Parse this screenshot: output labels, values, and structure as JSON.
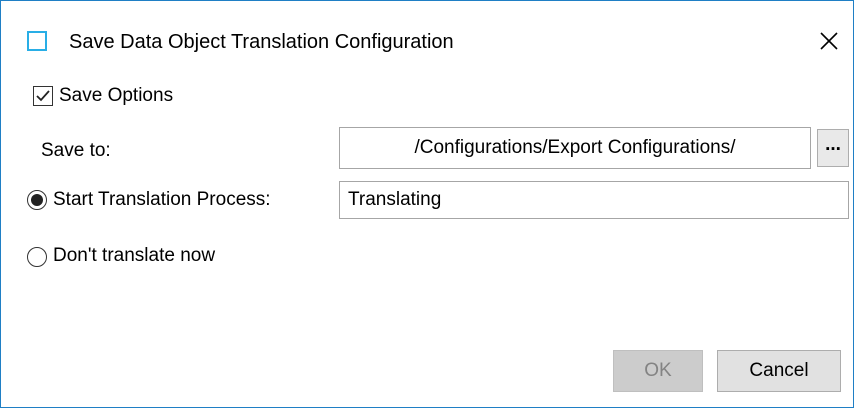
{
  "dialog": {
    "title": "Save Data Object Translation Configuration",
    "title_icon": "window-icon",
    "close_icon": "close-icon"
  },
  "save_options": {
    "label": "Save Options",
    "checked": true
  },
  "save_to": {
    "label": "Save to:",
    "value": "/Configurations/Export Configurations/",
    "browse_label": "..."
  },
  "start_translation": {
    "label": "Start Translation Process:",
    "selected": true,
    "value": "Translating"
  },
  "dont_translate": {
    "label": "Don't translate now",
    "selected": false
  },
  "buttons": {
    "ok": "OK",
    "ok_enabled": false,
    "cancel": "Cancel"
  },
  "colors": {
    "accent": "#29aee6",
    "window_border": "#1f7fc5",
    "disabled_bg": "#cccccc",
    "disabled_text": "#838383"
  }
}
